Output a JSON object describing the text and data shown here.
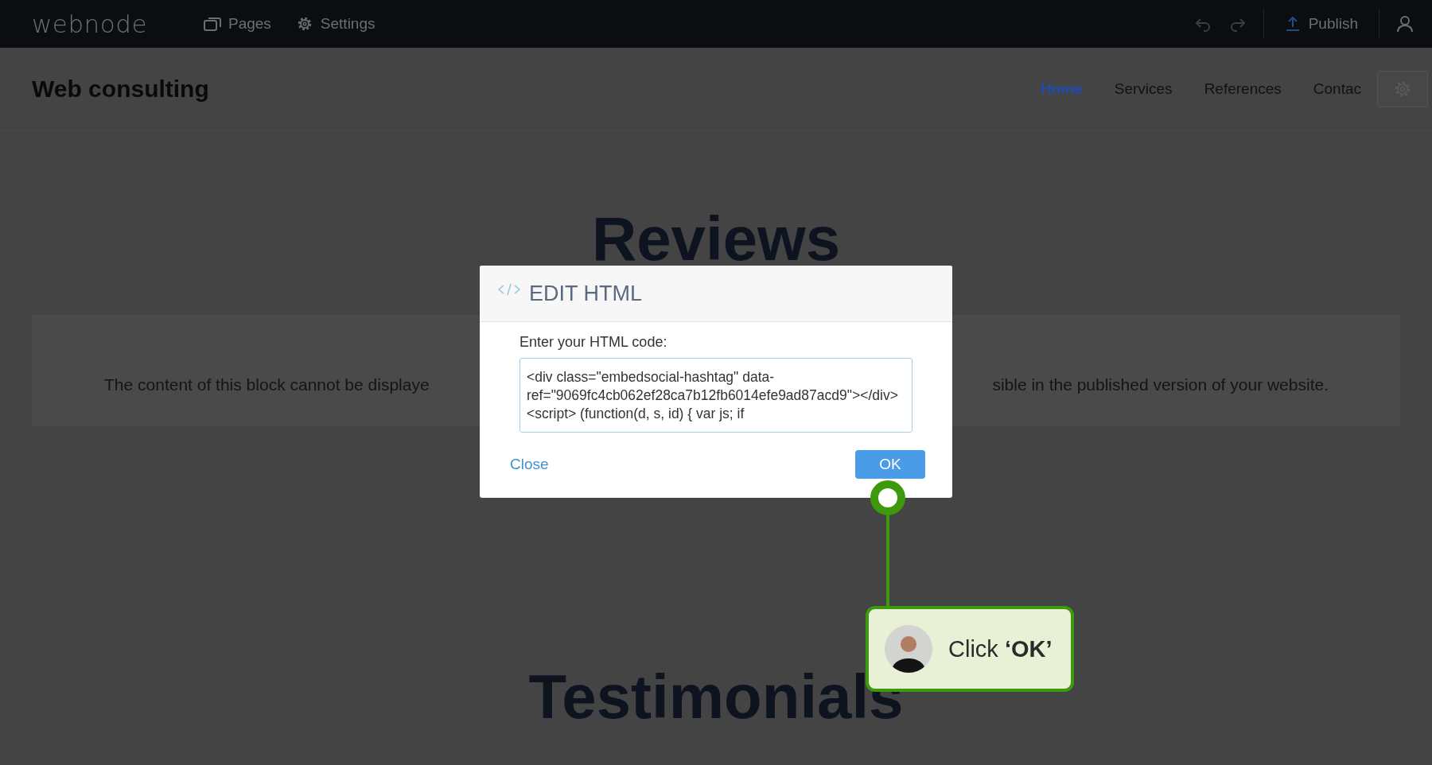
{
  "topbar": {
    "logo": "webnode",
    "menu": [
      {
        "label": "Pages",
        "kind": "pages"
      },
      {
        "label": "Settings",
        "kind": "settings"
      }
    ],
    "publish": "Publish"
  },
  "site": {
    "title": "Web consulting",
    "nav": [
      {
        "label": "Home",
        "selected": true
      },
      {
        "label": "Services",
        "selected": false
      },
      {
        "label": "References",
        "selected": false
      },
      {
        "label": "Contac",
        "selected": false
      }
    ]
  },
  "reviews_heading": "Reviews",
  "notice": {
    "left": "The content of this block cannot be displaye",
    "right": "sible in the published version of your website."
  },
  "testimonials_heading": "Testimonials",
  "dialog": {
    "title": "EDIT HTML",
    "label": "Enter your HTML code:",
    "code": "<div class=\"embedsocial-hashtag\" data-ref=\"9069fc4cb062ef28ca7b12fb6014efe9ad87acd9\"></div> <script> (function(d, s, id) { var js; if",
    "close": "Close",
    "ok": "OK"
  },
  "callout": {
    "text": "Click **‘OK’**"
  }
}
